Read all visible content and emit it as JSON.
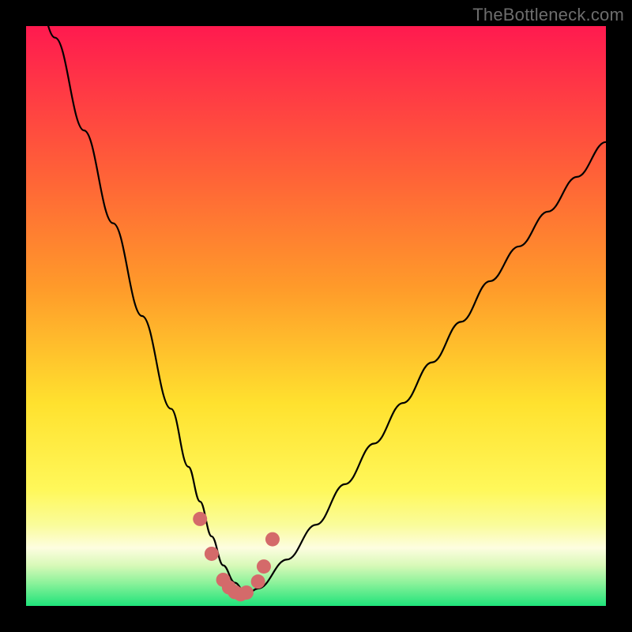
{
  "watermark": "TheBottleneck.com",
  "colors": {
    "frame": "#000000",
    "gradient_top": "#ff1a4f",
    "gradient_upper_mid": "#ff8a2c",
    "gradient_mid": "#ffe92e",
    "gradient_lower_mid": "#fafc8f",
    "gradient_band": "#fdfccf",
    "gradient_bottom": "#2bea80",
    "curve": "#000000",
    "marker_fill": "#d46a6a",
    "marker_stroke": "#b94f4f"
  },
  "chart_data": {
    "type": "line",
    "title": "",
    "xlabel": "",
    "ylabel": "",
    "xlim": [
      0,
      100
    ],
    "ylim": [
      0,
      100
    ],
    "series": [
      {
        "name": "bottleneck-curve",
        "x": [
          0,
          5,
          10,
          15,
          20,
          25,
          28,
          30,
          32,
          34,
          36,
          38,
          40,
          45,
          50,
          55,
          60,
          65,
          70,
          75,
          80,
          85,
          90,
          95,
          100
        ],
        "values": [
          115,
          98,
          82,
          66,
          50,
          34,
          24,
          18,
          12,
          7,
          4,
          2,
          3,
          8,
          14,
          21,
          28,
          35,
          42,
          49,
          56,
          62,
          68,
          74,
          80
        ]
      }
    ],
    "markers": {
      "name": "highlight-points",
      "x": [
        30,
        32,
        34,
        35,
        36,
        37,
        38,
        40,
        41,
        42.5
      ],
      "values": [
        15,
        9,
        4.5,
        3.2,
        2.4,
        2.0,
        2.3,
        4.2,
        6.8,
        11.5
      ]
    }
  }
}
